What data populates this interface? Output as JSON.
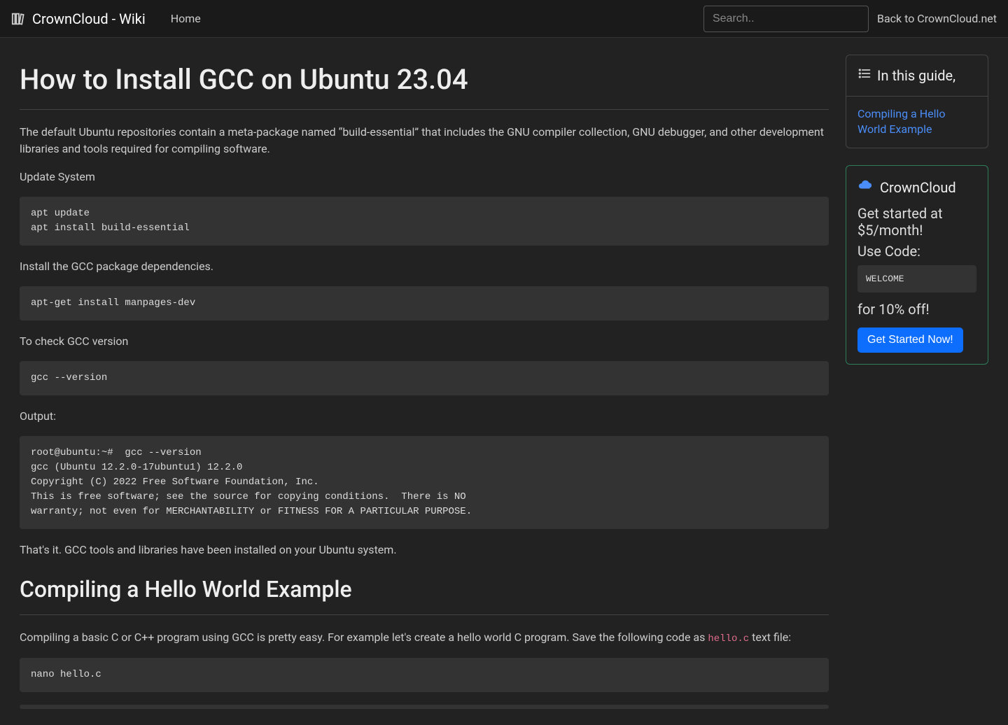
{
  "navbar": {
    "brand": "CrownCloud - Wiki",
    "home": "Home",
    "search_placeholder": "Search..",
    "back_link": "Back to CrownCloud.net"
  },
  "article": {
    "title": "How to Install GCC on Ubuntu 23.04",
    "intro": "The default Ubuntu repositories contain a meta-package named “build-essential” that includes the GNU compiler collection, GNU debugger, and other development libraries and tools required for compiling software.",
    "p_update": "Update System",
    "code_update": "apt update\napt install build-essential",
    "p_install_deps": "Install the GCC package dependencies.",
    "code_install_deps": "apt-get install manpages-dev",
    "p_check_version": "To check GCC version",
    "code_version": "gcc --version",
    "p_output": "Output:",
    "code_output": "root@ubuntu:~#  gcc --version\ngcc (Ubuntu 12.2.0-17ubuntu1) 12.2.0\nCopyright (C) 2022 Free Software Foundation, Inc.\nThis is free software; see the source for copying conditions.  There is NO\nwarranty; not even for MERCHANTABILITY or FITNESS FOR A PARTICULAR PURPOSE.",
    "p_done": "That's it. GCC tools and libraries have been installed on your Ubuntu system.",
    "h2_compile": "Compiling a Hello World Example",
    "p_compile_intro_pre": "Compiling a basic C or C++ program using GCC is pretty easy. For example let's create a hello world C program. Save the following code as ",
    "compile_filename": "hello.c",
    "p_compile_intro_post": " text file:",
    "code_nano": "nano hello.c"
  },
  "toc": {
    "heading": "In this guide,",
    "link1": "Compiling a Hello World Example"
  },
  "promo": {
    "title": "CrownCloud",
    "line1": "Get started at $5/month!",
    "line2": "Use Code:",
    "code": "WELCOME",
    "line3": "for 10% off!",
    "button": "Get Started Now!"
  }
}
